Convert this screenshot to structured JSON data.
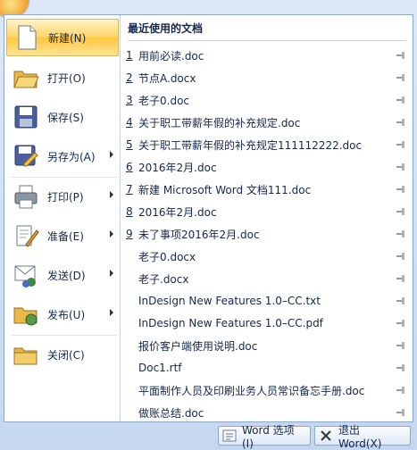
{
  "left_menu": {
    "items": [
      {
        "label": "新建(N)",
        "icon": "new-document-icon"
      },
      {
        "label": "打开(O)",
        "icon": "open-folder-icon"
      },
      {
        "label": "保存(S)",
        "icon": "save-disk-icon"
      },
      {
        "label": "另存为(A)",
        "icon": "save-as-icon"
      },
      {
        "label": "打印(P)",
        "icon": "printer-icon"
      },
      {
        "label": "准备(E)",
        "icon": "prepare-icon"
      },
      {
        "label": "发送(D)",
        "icon": "send-icon"
      },
      {
        "label": "发布(U)",
        "icon": "publish-icon"
      },
      {
        "label": "关闭(C)",
        "icon": "close-folder-icon"
      }
    ]
  },
  "recent": {
    "title": "最近使用的文档",
    "docs": [
      {
        "num": "1",
        "name": "用前必读.doc"
      },
      {
        "num": "2",
        "name": "节点A.docx"
      },
      {
        "num": "3",
        "name": "老子0.doc"
      },
      {
        "num": "4",
        "name": "关于职工带薪年假的补充规定.doc"
      },
      {
        "num": "5",
        "name": "关于职工带薪年假的补充规定111112222.doc"
      },
      {
        "num": "6",
        "name": "2016年2月.doc"
      },
      {
        "num": "7",
        "name": "新建 Microsoft Word 文档111.doc"
      },
      {
        "num": "8",
        "name": "2016年2月.doc"
      },
      {
        "num": "9",
        "name": "未了事项2016年2月.doc"
      },
      {
        "num": "",
        "name": "老子0.docx"
      },
      {
        "num": "",
        "name": "老子.docx"
      },
      {
        "num": "",
        "name": "InDesign New Features 1.0–CC.txt"
      },
      {
        "num": "",
        "name": "InDesign New Features 1.0–CC.pdf"
      },
      {
        "num": "",
        "name": "报价客户端使用说明.doc"
      },
      {
        "num": "",
        "name": "Doc1.rtf"
      },
      {
        "num": "",
        "name": "平面制作人员及印刷业务人员常识备忘手册.doc"
      },
      {
        "num": "",
        "name": "做账总结.doc"
      }
    ]
  },
  "bottom": {
    "options_label": "Word 选项(I)",
    "exit_label": "退出 Word(X)"
  }
}
